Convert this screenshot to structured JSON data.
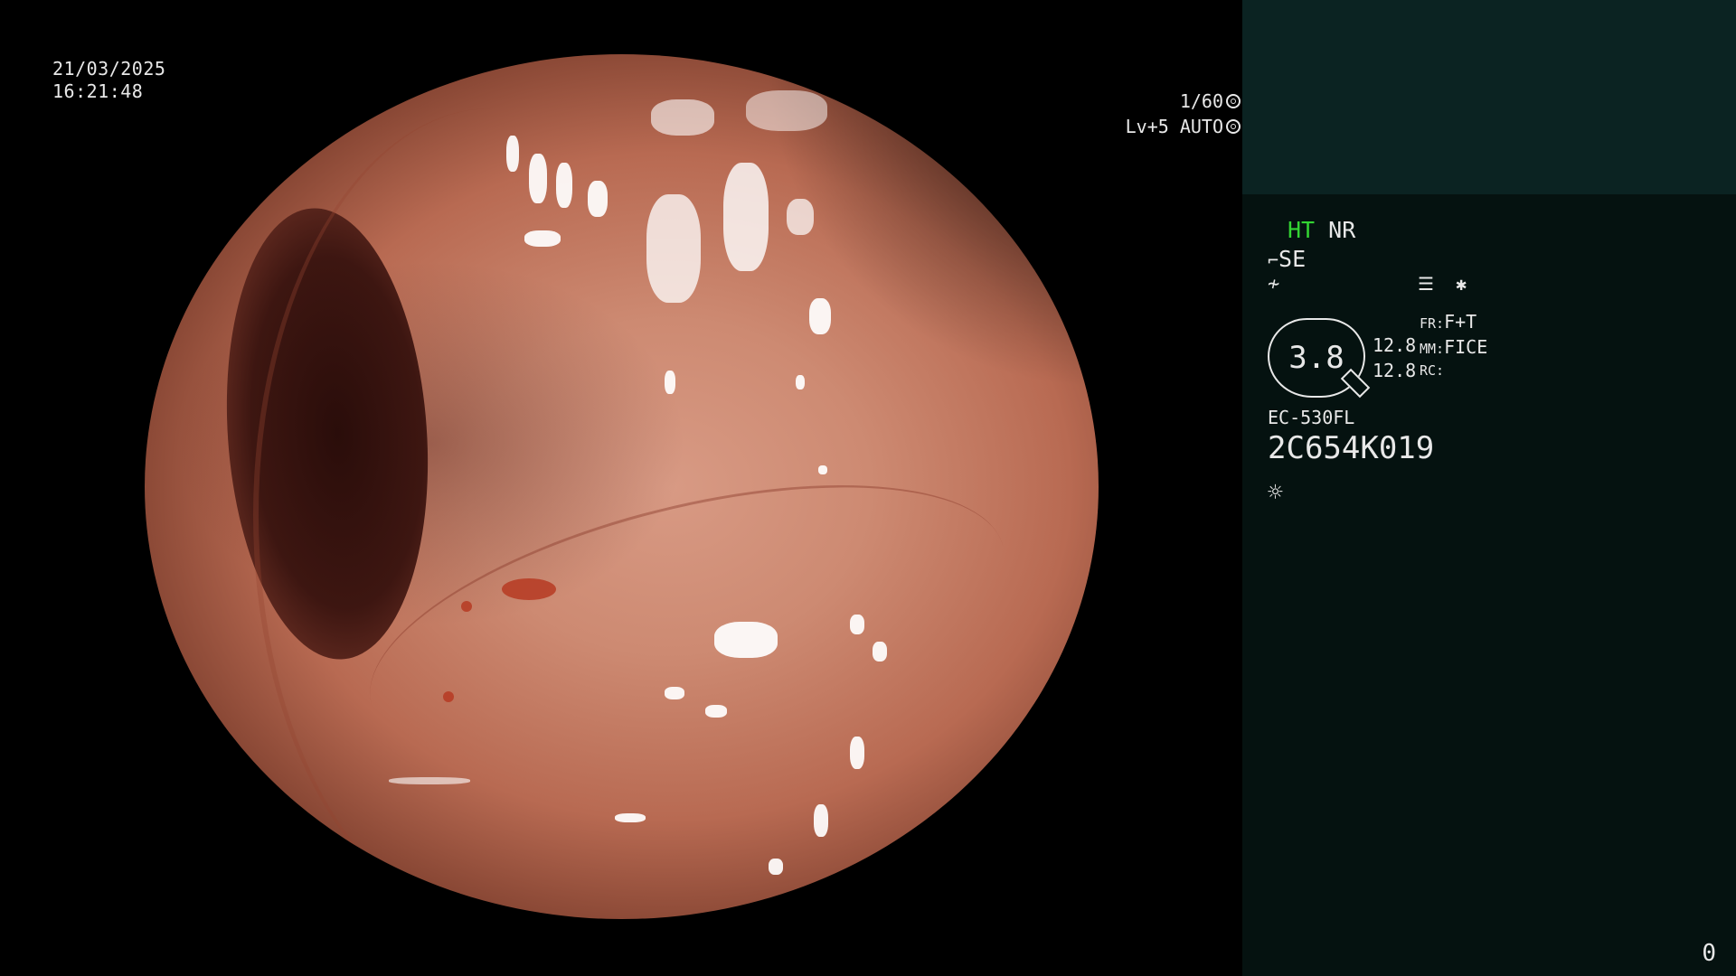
{
  "overlay": {
    "date": "21/03/2025",
    "time": "16:21:48",
    "shutter": "1/60",
    "level_mode": "Lv+5 AUTO"
  },
  "panel": {
    "ht_label": "HT",
    "nr_label": "NR",
    "se_label": "SE",
    "zoom_value": "3.8",
    "left_value_1": "12.8",
    "left_value_2": "12.8",
    "fr_label": "FR:",
    "fr_value": "F+T",
    "mm_label": "MM:",
    "mm_value": "FICE",
    "rc_label": "RC:",
    "scope_model": "EC-530FL",
    "serial": "2C654K019",
    "frame_counter": "0",
    "colors": {
      "ht_green": "#33d433",
      "panel_top": "#0b2322",
      "panel_bg": "#051210"
    },
    "icons": [
      "scope-se-icon",
      "freeze-icon",
      "menu-icon",
      "asterisk-icon",
      "light-icon"
    ]
  }
}
